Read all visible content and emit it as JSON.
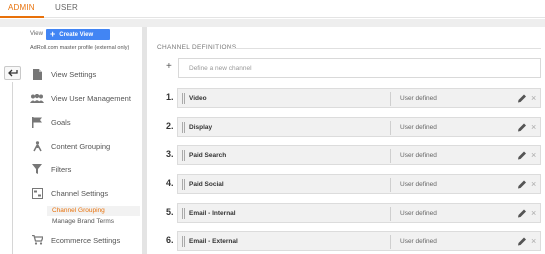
{
  "tabs": [
    {
      "label": "ADMIN",
      "active": true
    },
    {
      "label": "USER",
      "active": false
    }
  ],
  "accent_color": "#e8710a",
  "button_color": "#4285f4",
  "view": {
    "label": "View",
    "create_button": "Create View",
    "profile_name": "AdRoll.com master profile (external only)"
  },
  "menu": [
    {
      "label": "View Settings",
      "icon": "document-icon"
    },
    {
      "label": "View User Management",
      "icon": "users-icon"
    },
    {
      "label": "Goals",
      "icon": "flag-icon"
    },
    {
      "label": "Content Grouping",
      "icon": "person-tree-icon"
    },
    {
      "label": "Filters",
      "icon": "filter-icon"
    },
    {
      "label": "Channel Settings",
      "icon": "grid-settings-icon"
    },
    {
      "label": "Ecommerce Settings",
      "icon": "cart-icon"
    }
  ],
  "channel_settings_sub": [
    {
      "label": "Channel Grouping",
      "active": true
    },
    {
      "label": "Manage Brand Terms",
      "active": false
    }
  ],
  "section_title": "CHANNEL DEFINITIONS",
  "define_placeholder": "Define a new channel",
  "channels": [
    {
      "num": "1.",
      "name": "Video",
      "type": "User defined"
    },
    {
      "num": "2.",
      "name": "Display",
      "type": "User defined"
    },
    {
      "num": "3.",
      "name": "Paid Search",
      "type": "User defined"
    },
    {
      "num": "4.",
      "name": "Paid Social",
      "type": "User defined"
    },
    {
      "num": "5.",
      "name": "Email - Internal",
      "type": "User defined"
    },
    {
      "num": "6.",
      "name": "Email - External",
      "type": "User defined"
    }
  ]
}
